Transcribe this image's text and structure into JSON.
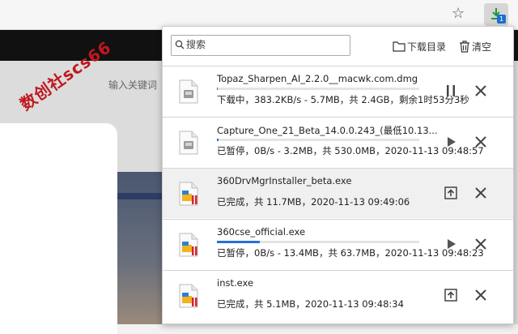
{
  "background_page": {
    "search_hint": "输入关键词",
    "watermark": "数创社scs66"
  },
  "extension": {
    "badge": "1"
  },
  "popup": {
    "search": {
      "placeholder": "搜索",
      "value": ""
    },
    "open_folder_label": "下载目录",
    "clear_label": "清空",
    "items": [
      {
        "name": "Topaz_Sharpen_AI_2.2.0__macwk.com.dmg",
        "status": "下载中，383.2KB/s - 5.7MB，共 2.4GB，剩余1时53分3秒",
        "progress_percent": 0.3,
        "state": "downloading",
        "action": "pause",
        "icon": "dmg-file-icon"
      },
      {
        "name": "Capture_One_21_Beta_14.0.0.243_(最低10.13...",
        "status": "已暂停，0B/s - 3.2MB，共 530.0MB，2020-11-13 09:48:57",
        "progress_percent": 0.6,
        "state": "paused",
        "action": "resume",
        "icon": "dmg-file-icon"
      },
      {
        "name": "360DrvMgrInstaller_beta.exe",
        "status": "已完成，共 11.7MB，2020-11-13 09:49:06",
        "progress_percent": 100,
        "state": "done",
        "action": "open",
        "icon": "exe-file-icon"
      },
      {
        "name": "360cse_official.exe",
        "status": "已暂停，0B/s - 13.4MB，共 63.7MB，2020-11-13 09:48:23",
        "progress_percent": 21,
        "state": "paused",
        "action": "resume",
        "icon": "exe-file-icon"
      },
      {
        "name": "inst.exe",
        "status": "已完成，共 5.1MB，2020-11-13 09:48:34",
        "progress_percent": 100,
        "state": "done",
        "action": "open",
        "icon": "exe-file-icon"
      }
    ]
  },
  "colors": {
    "accent": "#2b6fd6",
    "watermark": "#c0181f",
    "highlight_row": "#f0f0f0"
  }
}
